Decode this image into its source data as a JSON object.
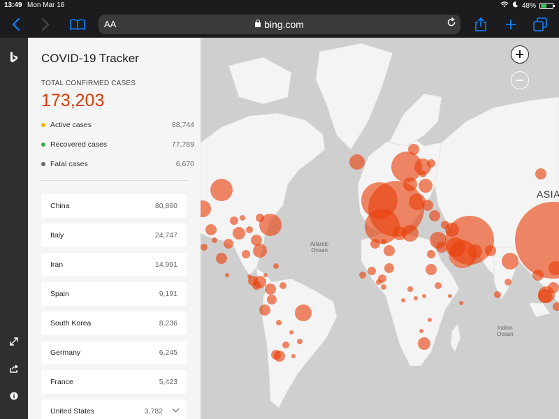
{
  "status_bar": {
    "time": "13:49",
    "date": "Mon Mar 16",
    "battery": "48%"
  },
  "browser": {
    "text_size_label": "AA",
    "url": "bing.com"
  },
  "colors": {
    "accent": "#0a84ff",
    "total_cases": "#d83b01",
    "bubble": "#e8410c",
    "active": "#f0b400",
    "recovered": "#3fae49",
    "fatal": "#666666"
  },
  "tracker": {
    "title": "COVID-19 Tracker",
    "total_label": "TOTAL CONFIRMED CASES",
    "total_value": "173,203",
    "stats": [
      {
        "label": "Active cases",
        "value": "88,744",
        "color": "#f0b400"
      },
      {
        "label": "Recovered cases",
        "value": "77,789",
        "color": "#3fae49"
      },
      {
        "label": "Fatal cases",
        "value": "6,670",
        "color": "#666666"
      }
    ],
    "countries": [
      {
        "name": "China",
        "value": "80,860"
      },
      {
        "name": "Italy",
        "value": "24,747"
      },
      {
        "name": "Iran",
        "value": "14,991"
      },
      {
        "name": "Spain",
        "value": "9,191"
      },
      {
        "name": "South Korea",
        "value": "8,236"
      },
      {
        "name": "Germany",
        "value": "6,245"
      },
      {
        "name": "France",
        "value": "5,423"
      },
      {
        "name": "United States",
        "value": "3,782"
      }
    ]
  },
  "map": {
    "labels": {
      "atlantic": "Atlantic\nOcean",
      "indian": "Indian\nOcean",
      "asia": "ASIA"
    },
    "zoom_in": "Zoom in",
    "zoom_out": "Zoom out"
  }
}
